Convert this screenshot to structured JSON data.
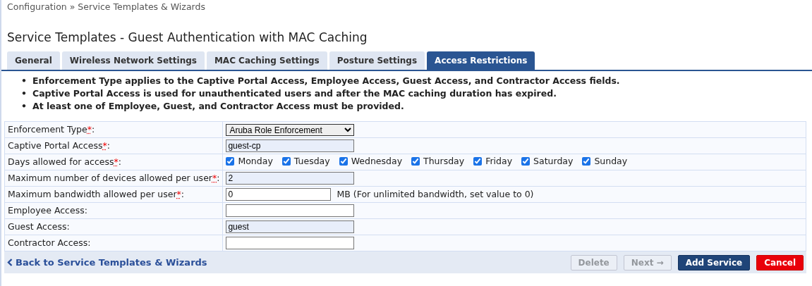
{
  "breadcrumb": "Configuration » Service Templates & Wizards",
  "title": "Service Templates - Guest Authentication with MAC Caching",
  "tabs": [
    {
      "label": "General",
      "selected": false
    },
    {
      "label": "Wireless Network Settings",
      "selected": false
    },
    {
      "label": "MAC Caching Settings",
      "selected": false
    },
    {
      "label": "Posture Settings",
      "selected": false
    },
    {
      "label": "Access Restrictions",
      "selected": true
    }
  ],
  "bullet": "•",
  "required_mark": "*",
  "label_suffix": ":",
  "notes": [
    "Enforcement Type applies to the Captive Portal Access, Employee Access, Guest Access, and Contractor Access fields.",
    "Captive Portal Access is used for unauthenticated users and after the MAC caching duration has expired.",
    "At least one of Employee, Guest, and Contractor Access must be provided."
  ],
  "fields": [
    {
      "label": "Enforcement Type",
      "required": true,
      "kind": "select",
      "value": "Aruba Role Enforcement"
    },
    {
      "label": "Captive Portal Access",
      "required": true,
      "kind": "text",
      "value": "guest-cp",
      "autofilled": true
    },
    {
      "label": "Days allowed for access",
      "required": true,
      "kind": "days",
      "days": [
        {
          "label": "Monday",
          "checked": true
        },
        {
          "label": "Tuesday",
          "checked": true
        },
        {
          "label": "Wednesday",
          "checked": true
        },
        {
          "label": "Thursday",
          "checked": true
        },
        {
          "label": "Friday",
          "checked": true
        },
        {
          "label": "Saturday",
          "checked": true
        },
        {
          "label": "Sunday",
          "checked": true
        }
      ]
    },
    {
      "label": "Maximum number of devices allowed per user",
      "required": true,
      "kind": "text",
      "value": "2",
      "autofilled": true
    },
    {
      "label": "Maximum bandwidth allowed per user",
      "required": true,
      "kind": "short",
      "value": "0",
      "autofilled": false,
      "hint": "MB (For unlimited bandwidth, set value to 0)"
    },
    {
      "label": "Employee Access",
      "required": false,
      "kind": "text",
      "autofilled": false
    },
    {
      "label": "Guest Access",
      "required": false,
      "kind": "text",
      "value": "guest",
      "autofilled": true
    },
    {
      "label": "Contractor Access",
      "required": false,
      "kind": "text",
      "autofilled": false
    }
  ],
  "back_link": "Back to Service Templates & Wizards",
  "buttons": [
    {
      "label": "Delete",
      "kind": "secondary",
      "disabled": true
    },
    {
      "label": "Next →",
      "kind": "secondary",
      "disabled": true
    },
    {
      "label": "Add Service",
      "kind": "primary",
      "disabled": false
    },
    {
      "label": "Cancel",
      "kind": "danger",
      "disabled": false
    }
  ]
}
